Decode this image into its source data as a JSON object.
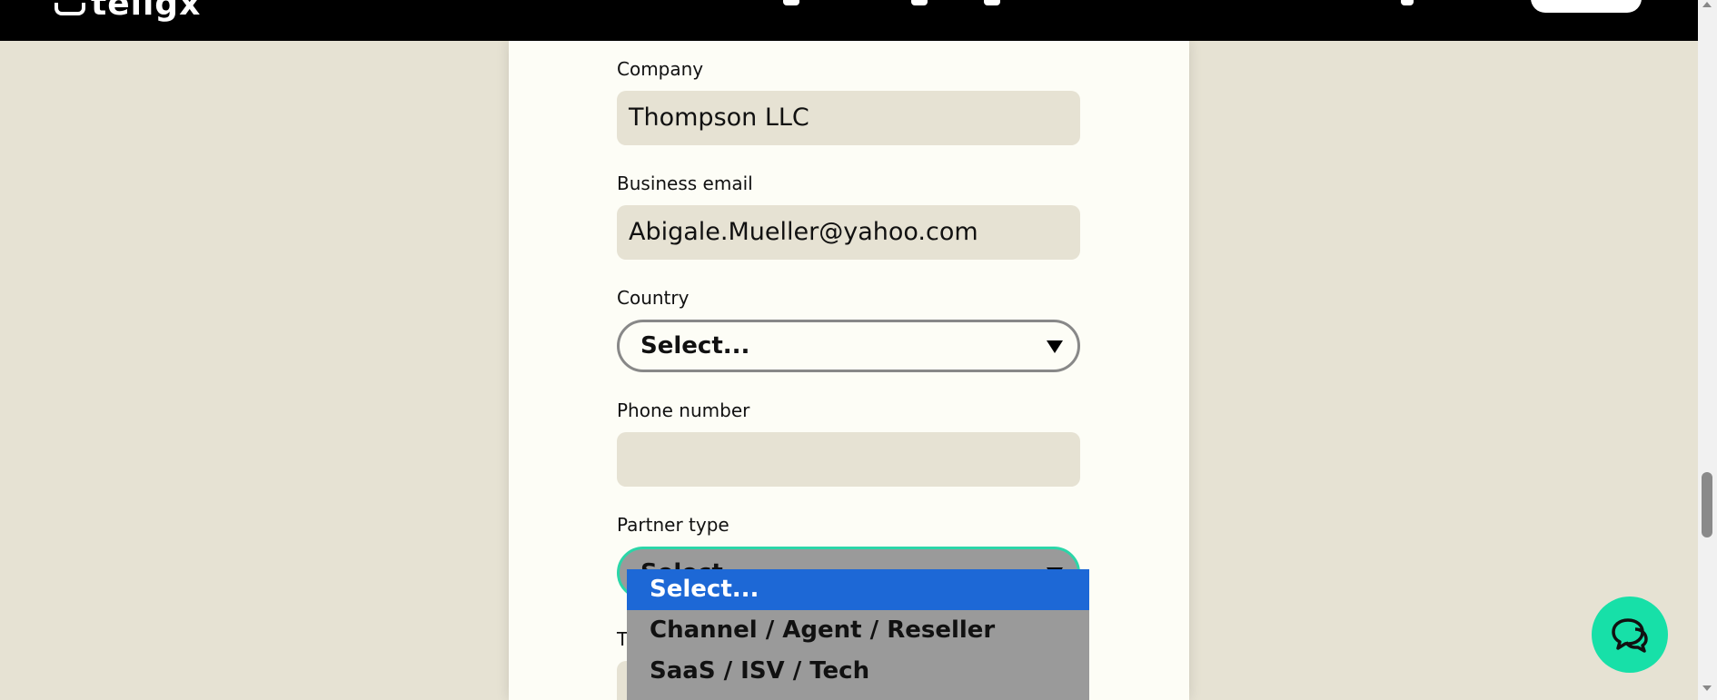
{
  "nav": {
    "logo_text": "tellgx"
  },
  "form": {
    "company": {
      "label": "Company",
      "value": "Thompson LLC"
    },
    "business_email": {
      "label": "Business email",
      "value": "Abigale.Mueller@yahoo.com"
    },
    "country": {
      "label": "Country",
      "value": "Select..."
    },
    "phone_number": {
      "label": "Phone number",
      "value": ""
    },
    "partner_type": {
      "label": "Partner type",
      "value": "Select...",
      "options": [
        "Select...",
        "Channel / Agent / Reseller",
        "SaaS / ISV / Tech"
      ]
    },
    "next_label_partial": "T"
  },
  "colors": {
    "accent": "#2bd6a8",
    "option_highlight": "#1d68d6",
    "field_bg": "#e6e2d3"
  },
  "icons": {
    "chat": "chat-bubbles-icon",
    "dropdown": "caret-down-icon"
  }
}
